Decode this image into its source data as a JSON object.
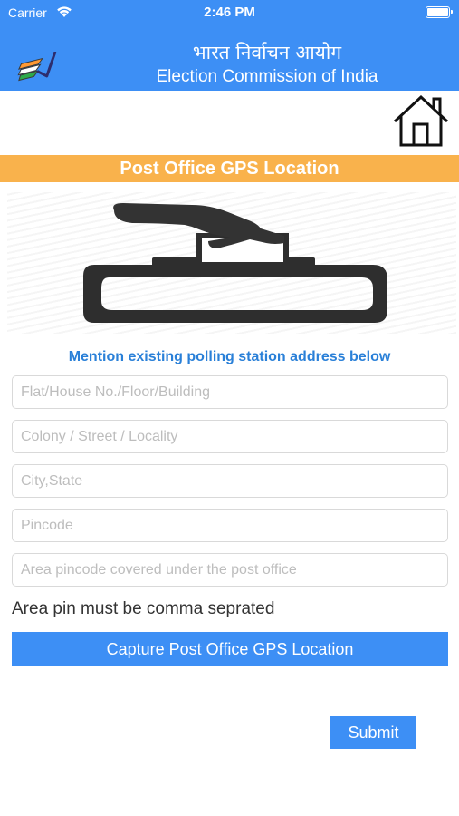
{
  "status_bar": {
    "carrier": "Carrier",
    "time": "2:46 PM"
  },
  "header": {
    "hindi_title": "भारत निर्वाचन आयोग",
    "english_title": "Election Commission of India",
    "background_color": "#3d8ff5",
    "logo_icon": "eci-flag-tick-logo"
  },
  "home_icon": "home-icon",
  "banner": {
    "title": "Post Office GPS Location",
    "color": "#f9b24c"
  },
  "hero_icon": "ballot-box-voting-icon",
  "form": {
    "instruction": "Mention existing polling station address below",
    "fields": [
      {
        "placeholder": "Flat/House No./Floor/Building",
        "value": ""
      },
      {
        "placeholder": "Colony / Street / Locality",
        "value": ""
      },
      {
        "placeholder": "City,State",
        "value": ""
      },
      {
        "placeholder": "Pincode",
        "value": ""
      },
      {
        "placeholder": "Area pincode covered under the post office",
        "value": ""
      }
    ],
    "note": "Area pin must be comma seprated",
    "capture_label": "Capture Post Office GPS Location",
    "submit_label": "Submit"
  }
}
